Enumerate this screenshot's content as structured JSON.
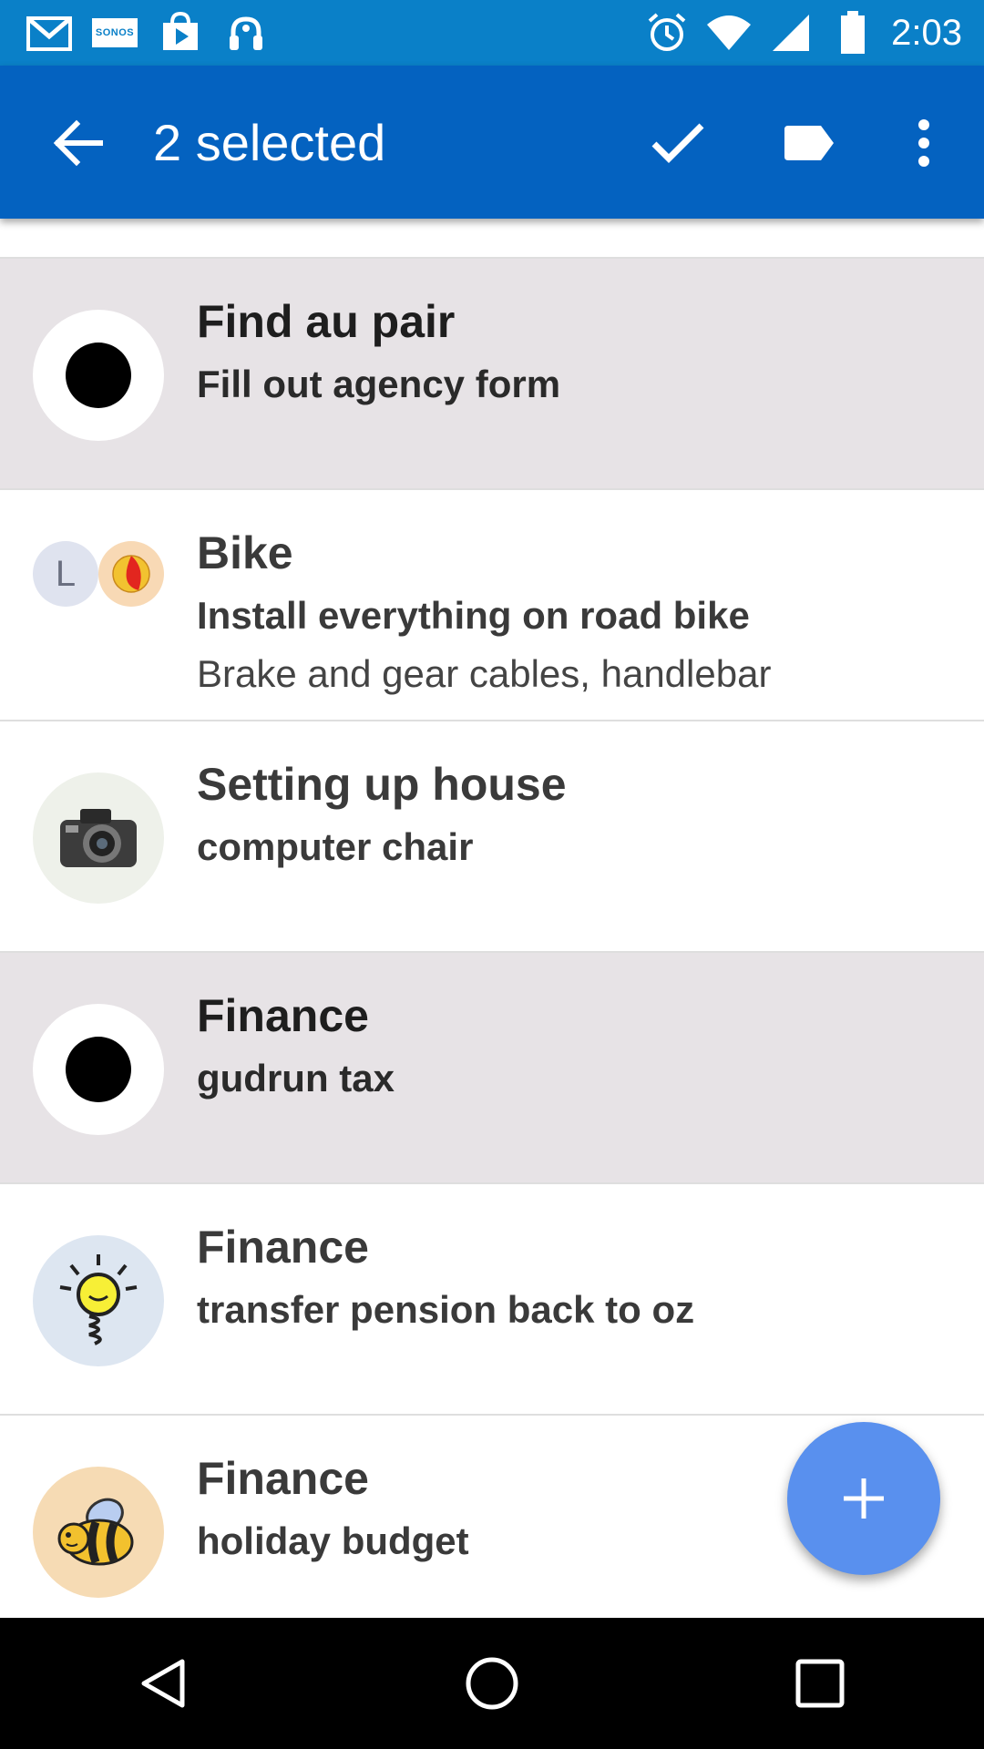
{
  "status_bar": {
    "time": "2:03",
    "left_icons": [
      "gmail-icon",
      "sonos-icon",
      "play-store-icon",
      "amazon-icon"
    ],
    "sonos_text": "SONOS",
    "right_icons": [
      "alarm-icon",
      "wifi-icon",
      "signal-icon",
      "battery-icon"
    ]
  },
  "toolbar": {
    "title": "2 selected",
    "back_icon": "arrow-back-icon",
    "actions": [
      "check-icon",
      "label-icon",
      "more-vert-icon"
    ]
  },
  "list": {
    "items": [
      {
        "title": "Find au pair",
        "subtitle": "Fill out agency form",
        "note": "",
        "selected": true,
        "avatar": "selected-dot"
      },
      {
        "title": "Bike",
        "subtitle": "Install everything on road bike",
        "note": "Brake and gear cables, handlebar",
        "selected": false,
        "avatar": "dual",
        "avatar_letter": "L"
      },
      {
        "title": "Setting up house",
        "subtitle": "computer chair",
        "note": "",
        "selected": false,
        "avatar": "camera-icon"
      },
      {
        "title": "Finance",
        "subtitle": "gudrun tax",
        "note": "",
        "selected": true,
        "avatar": "selected-dot"
      },
      {
        "title": "Finance",
        "subtitle": "transfer pension back to oz",
        "note": "",
        "selected": false,
        "avatar": "lightbulb-icon"
      },
      {
        "title": "Finance",
        "subtitle": "holiday budget",
        "note": "",
        "selected": false,
        "avatar": "bee-icon"
      }
    ]
  },
  "fab": {
    "icon": "plus-icon"
  },
  "nav": {
    "icons": [
      "back-triangle-icon",
      "home-circle-icon",
      "recents-square-icon"
    ]
  },
  "colors": {
    "status_bar": "#0a80c8",
    "toolbar": "#0462c0",
    "selected_row": "#e7e3e6",
    "fab": "#5990ee"
  }
}
